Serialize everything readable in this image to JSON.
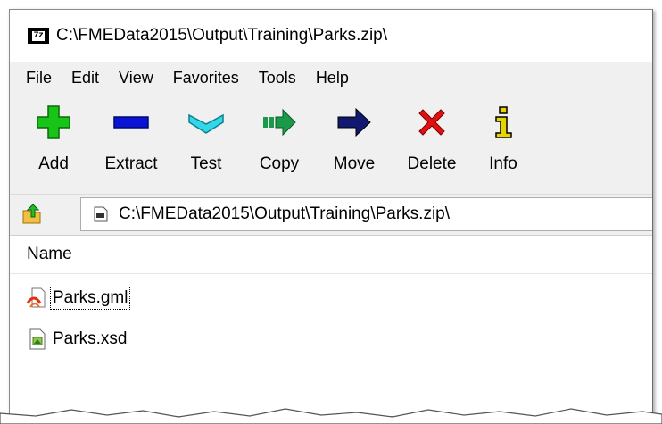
{
  "window": {
    "title": "C:\\FMEData2015\\Output\\Training\\Parks.zip\\",
    "app_icon_text": "7z",
    "app_icon": "7zip-icon"
  },
  "menu": [
    "File",
    "Edit",
    "View",
    "Favorites",
    "Tools",
    "Help"
  ],
  "toolbar": {
    "add": {
      "label": "Add",
      "icon": "plus-icon",
      "color": "#18c418"
    },
    "extract": {
      "label": "Extract",
      "icon": "minus-icon",
      "color": "#0a14d6"
    },
    "test": {
      "label": "Test",
      "icon": "check-chevron-icon",
      "color": "#33d8e8"
    },
    "copy": {
      "label": "Copy",
      "icon": "copy-arrow-icon",
      "color": "#1a9a4a"
    },
    "move": {
      "label": "Move",
      "icon": "move-arrow-icon",
      "color": "#101870"
    },
    "delete": {
      "label": "Delete",
      "icon": "x-icon",
      "color": "#e01010"
    },
    "info": {
      "label": "Info",
      "icon": "info-icon",
      "color": "#e8d400"
    }
  },
  "address": {
    "path": "C:\\FMEData2015\\Output\\Training\\Parks.zip\\",
    "icon": "archive-icon"
  },
  "list": {
    "columns": [
      "Name"
    ],
    "items": [
      {
        "name": "Parks.gml",
        "icon": "gml-file-icon",
        "focused": true
      },
      {
        "name": "Parks.xsd",
        "icon": "xsd-file-icon",
        "focused": false
      }
    ]
  }
}
